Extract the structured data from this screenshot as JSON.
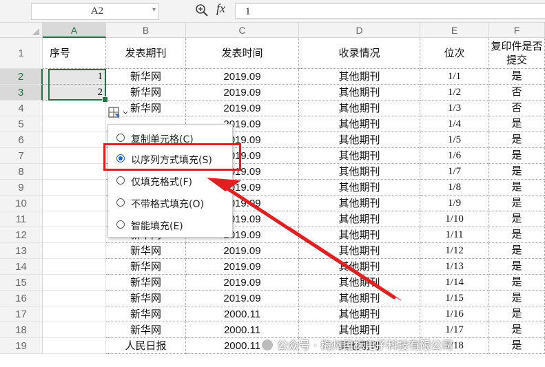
{
  "formula_bar": {
    "name_box": "A2",
    "fx_label": "fx",
    "formula_value": "1"
  },
  "columns": [
    "A",
    "B",
    "C",
    "D",
    "E",
    "F"
  ],
  "header_row": {
    "row_num": "1",
    "cells": [
      "序号",
      "发表期刊",
      "发表时间",
      "收录情况",
      "位次",
      "复印件是否提交"
    ]
  },
  "rows": [
    {
      "num": "2",
      "a": "1",
      "b": "新华网",
      "c": "2019.09",
      "d": "其他期刊",
      "e": "1/1",
      "f": "是"
    },
    {
      "num": "3",
      "a": "2",
      "b": "新华网",
      "c": "2019.09",
      "d": "其他期刊",
      "e": "1/2",
      "f": "否"
    },
    {
      "num": "4",
      "a": "",
      "b": "新华网",
      "c": "2019.09",
      "d": "其他期刊",
      "e": "1/3",
      "f": "否"
    },
    {
      "num": "5",
      "a": "",
      "b": "",
      "c": "2019.09",
      "d": "其他期刊",
      "e": "1/4",
      "f": "是"
    },
    {
      "num": "6",
      "a": "",
      "b": "",
      "c": "2019.09",
      "d": "其他期刊",
      "e": "1/5",
      "f": "是"
    },
    {
      "num": "7",
      "a": "",
      "b": "",
      "c": "2019.09",
      "d": "其他期刊",
      "e": "1/6",
      "f": "是"
    },
    {
      "num": "8",
      "a": "",
      "b": "",
      "c": "2019.09",
      "d": "其他期刊",
      "e": "1/7",
      "f": "是"
    },
    {
      "num": "9",
      "a": "",
      "b": "",
      "c": "2019.09",
      "d": "其他期刊",
      "e": "1/8",
      "f": "是"
    },
    {
      "num": "10",
      "a": "",
      "b": "",
      "c": "2019.09",
      "d": "其他期刊",
      "e": "1/9",
      "f": "是"
    },
    {
      "num": "11",
      "a": "",
      "b": "",
      "c": "2019.09",
      "d": "其他期刊",
      "e": "1/10",
      "f": "是"
    },
    {
      "num": "12",
      "a": "",
      "b": "新华网",
      "c": "2019.09",
      "d": "其他期刊",
      "e": "1/11",
      "f": "是"
    },
    {
      "num": "13",
      "a": "",
      "b": "新华网",
      "c": "2019.09",
      "d": "其他期刊",
      "e": "1/12",
      "f": "是"
    },
    {
      "num": "14",
      "a": "",
      "b": "新华网",
      "c": "2019.09",
      "d": "其他期刊",
      "e": "1/13",
      "f": "是"
    },
    {
      "num": "15",
      "a": "",
      "b": "新华网",
      "c": "2019.09",
      "d": "其他期刊",
      "e": "1/14",
      "f": "是"
    },
    {
      "num": "16",
      "a": "",
      "b": "新华网",
      "c": "2019.09",
      "d": "其他期刊",
      "e": "1/15",
      "f": "是"
    },
    {
      "num": "17",
      "a": "",
      "b": "新华网",
      "c": "2000.11",
      "d": "其他期刊",
      "e": "1/16",
      "f": "是"
    },
    {
      "num": "18",
      "a": "",
      "b": "新华网",
      "c": "2000.11",
      "d": "其他期刊",
      "e": "1/17",
      "f": "是"
    },
    {
      "num": "19",
      "a": "",
      "b": "人民日报",
      "c": "2000.11",
      "d": "其他期刊",
      "e": "1/18",
      "f": "是"
    }
  ],
  "autofill_menu": {
    "options": [
      {
        "label": "复制单元格(C)",
        "selected": false
      },
      {
        "label": "以序列方式填充(S)",
        "selected": true
      },
      {
        "label": "仅填充格式(F)",
        "selected": false
      },
      {
        "label": "不带格式填充(O)",
        "selected": false
      },
      {
        "label": "智能填充(E)",
        "selected": false
      }
    ]
  },
  "watermark": "公众号 · 梅州目标电子科技有限公司",
  "colors": {
    "selection": "#217346",
    "radio_selected": "#1a5fd0",
    "annotation": "#e02020"
  }
}
